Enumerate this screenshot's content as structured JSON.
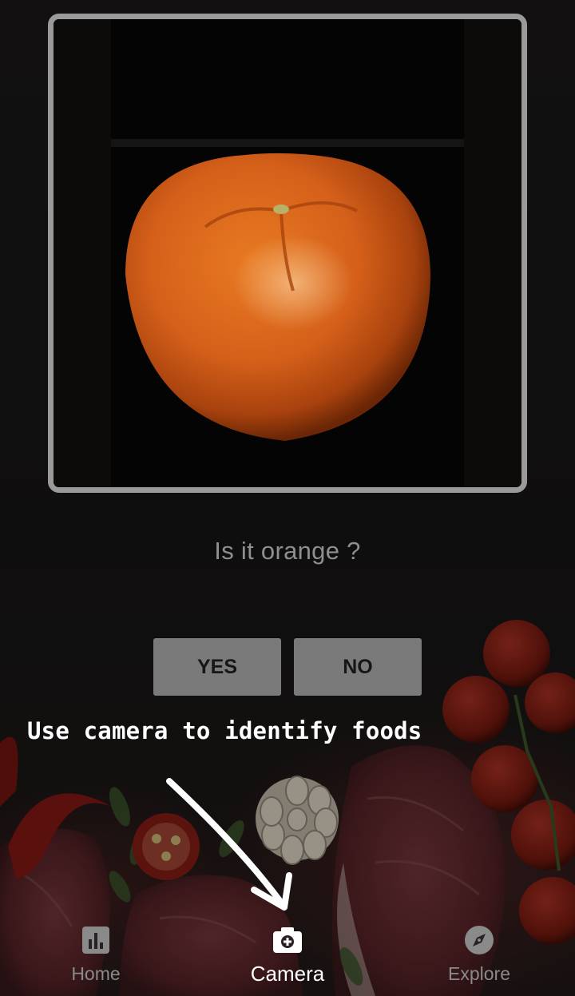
{
  "preview": {
    "image_icon": "orange-fruit-photo"
  },
  "prompt": {
    "question": "Is it orange ?"
  },
  "actions": {
    "yes_label": "YES",
    "no_label": "NO"
  },
  "hint": {
    "text": "Use camera to identify foods",
    "arrow_icon": "curved-arrow-icon"
  },
  "bottom_nav": {
    "items": [
      {
        "label": "Home",
        "icon": "bar-chart-icon",
        "active": false
      },
      {
        "label": "Camera",
        "icon": "camera-icon",
        "active": true
      },
      {
        "label": "Explore",
        "icon": "compass-icon",
        "active": false
      }
    ]
  },
  "colors": {
    "background": "#161414",
    "frame_border": "#9a9a9a",
    "button_bg": "#7a7a7a",
    "nav_active": "#ffffff",
    "nav_inactive": "#8a8a8a"
  }
}
